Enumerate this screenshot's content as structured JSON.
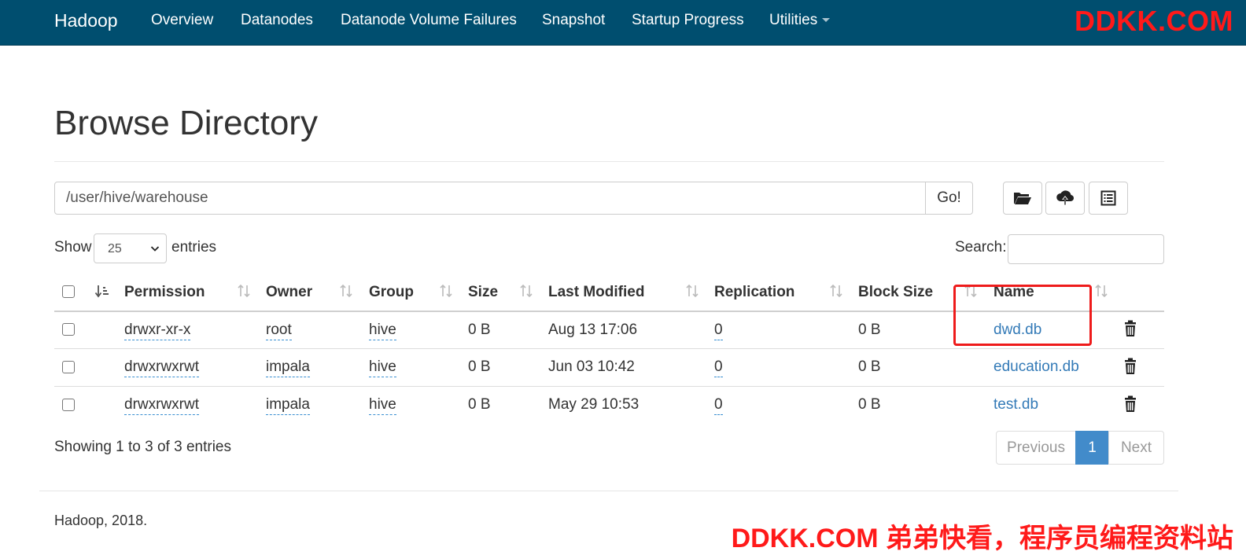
{
  "navbar": {
    "brand": "Hadoop",
    "items": [
      "Overview",
      "Datanodes",
      "Datanode Volume Failures",
      "Snapshot",
      "Startup Progress",
      "Utilities"
    ]
  },
  "watermark_top": "DDKK.COM",
  "page_title": "Browse Directory",
  "path_bar": {
    "value": "/user/hive/warehouse",
    "go_label": "Go!"
  },
  "toolbar_icons": [
    "folder-open-icon",
    "cloud-upload-icon",
    "list-alt-icon"
  ],
  "length_menu": {
    "show_label": "Show",
    "selected": "25",
    "entries_label": "entries"
  },
  "search": {
    "label": "Search:",
    "value": ""
  },
  "table": {
    "columns": [
      "Permission",
      "Owner",
      "Group",
      "Size",
      "Last Modified",
      "Replication",
      "Block Size",
      "Name"
    ],
    "rows": [
      {
        "permission": "drwxr-xr-x",
        "owner": "root",
        "group": "hive",
        "size": "0 B",
        "last_modified": "Aug 13 17:06",
        "replication": "0",
        "block_size": "0 B",
        "name": "dwd.db"
      },
      {
        "permission": "drwxrwxrwt",
        "owner": "impala",
        "group": "hive",
        "size": "0 B",
        "last_modified": "Jun 03 10:42",
        "replication": "0",
        "block_size": "0 B",
        "name": "education.db"
      },
      {
        "permission": "drwxrwxrwt",
        "owner": "impala",
        "group": "hive",
        "size": "0 B",
        "last_modified": "May 29 10:53",
        "replication": "0",
        "block_size": "0 B",
        "name": "test.db"
      }
    ]
  },
  "info_text": "Showing 1 to 3 of 3 entries",
  "pagination": {
    "previous": "Previous",
    "current": "1",
    "next": "Next"
  },
  "footer_text": "Hadoop, 2018.",
  "watermark_bottom": "DDKK.COM 弟弟快看，程序员编程资料站",
  "colors": {
    "navbar": "#004e6f",
    "link": "#337ab7",
    "active_page": "#428bca",
    "watermark": "#ff1a1a",
    "highlight_box": "#ee1b1b"
  }
}
